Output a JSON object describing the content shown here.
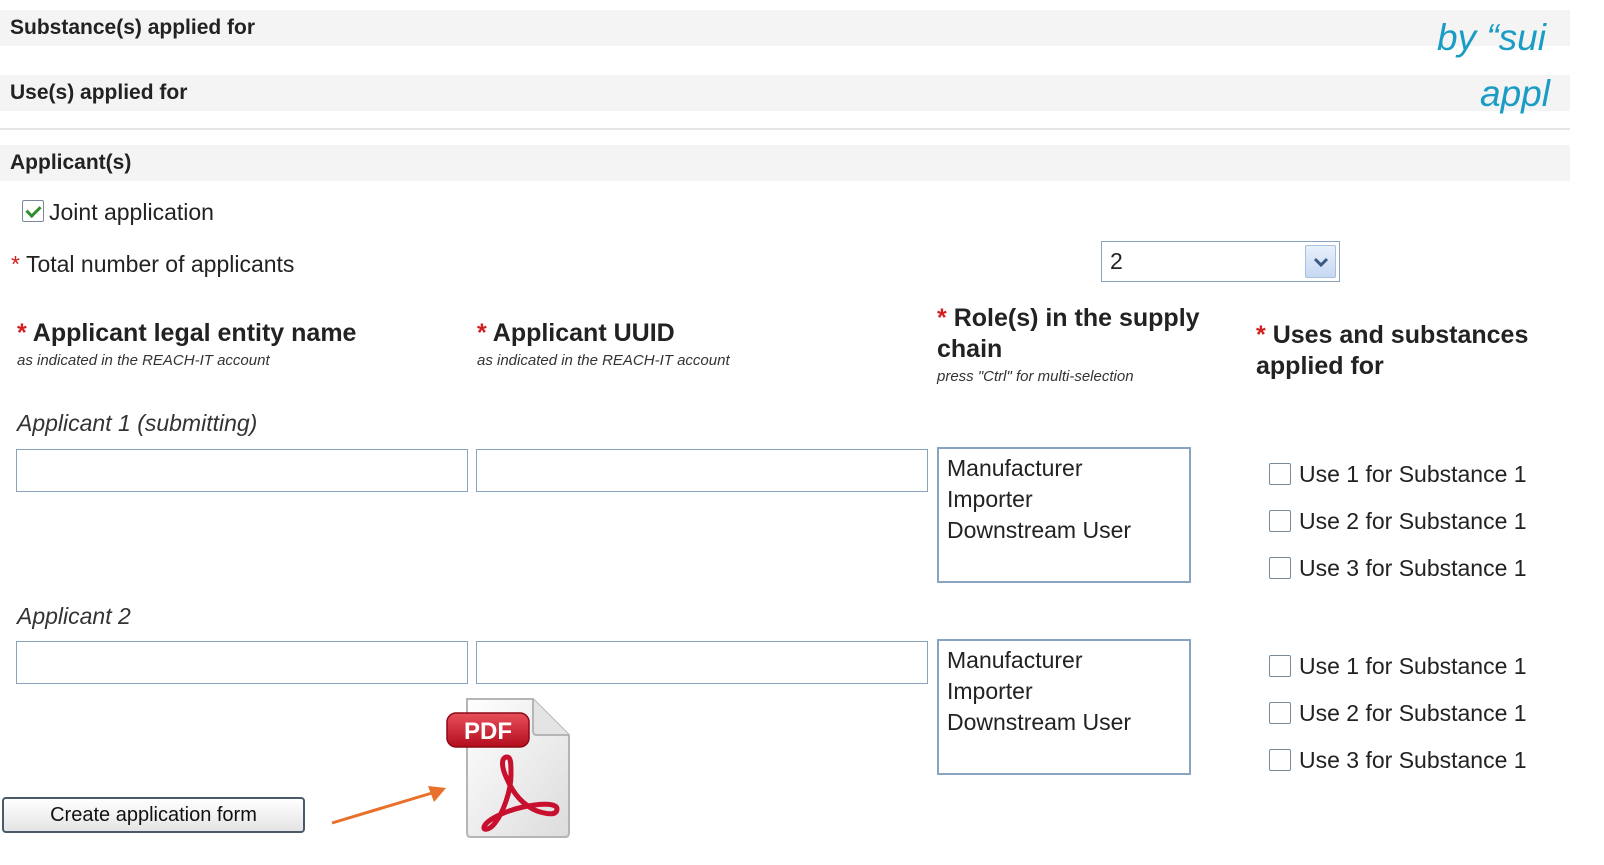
{
  "sections": {
    "substances": "Substance(s) applied for",
    "uses": "Use(s) applied for",
    "applicants": "Applicant(s)"
  },
  "overlay": {
    "line1": "by “sui",
    "line2": "appl"
  },
  "joint_application": {
    "label": "Joint application",
    "checked": true
  },
  "total_applicants": {
    "asterisk": "*",
    "label": "Total number of applicants",
    "selected": "2"
  },
  "columns": {
    "legal_name": {
      "title": "Applicant legal entity name",
      "subtitle": "as indicated in the REACH-IT account"
    },
    "uuid": {
      "title": "Applicant UUID",
      "subtitle": "as indicated in the REACH-IT account"
    },
    "roles": {
      "title_line1": "Role(s) in the supply",
      "title_line2": "chain",
      "subtitle": "press \"Ctrl\" for multi-selection"
    },
    "uses": {
      "title_line1": "Uses and substances",
      "title_line2": "applied for"
    }
  },
  "applicants": [
    {
      "title": "Applicant 1 (submitting)",
      "roles": [
        "Manufacturer",
        "Importer",
        "Downstream User"
      ],
      "uses": [
        "Use 1 for Substance 1",
        "Use 2 for Substance 1",
        "Use 3 for Substance 1"
      ]
    },
    {
      "title": "Applicant 2",
      "roles": [
        "Manufacturer",
        "Importer",
        "Downstream User"
      ],
      "uses": [
        "Use 1 for Substance 1",
        "Use 2 for Substance 1",
        "Use 3 for Substance 1"
      ]
    }
  ],
  "create_button": "Create application form",
  "pdf_badge": "PDF",
  "colors": {
    "accent": "#1a9cc4",
    "arrow": "#e8702a",
    "pdf_red": "#c8102e"
  }
}
